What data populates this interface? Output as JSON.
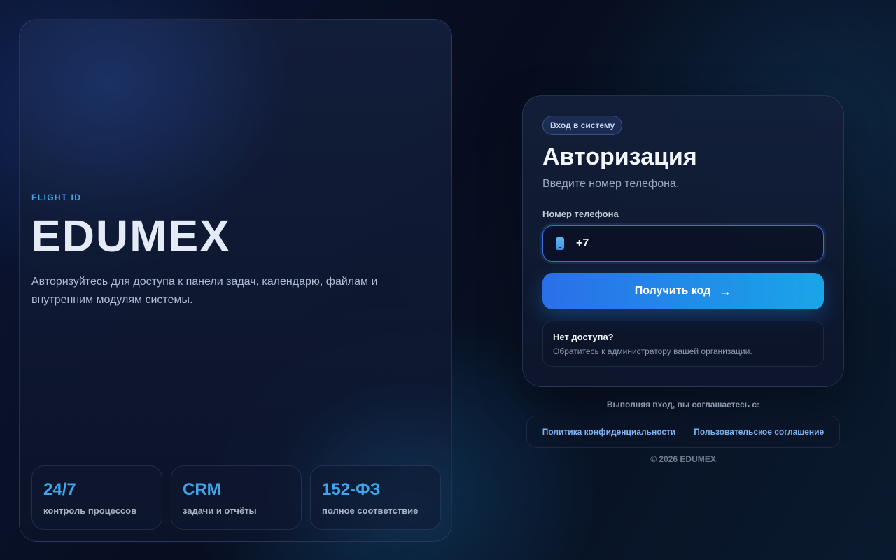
{
  "hero": {
    "eyebrow": "FLIGHT ID",
    "title": "EDUMEX",
    "description": "Авторизуйтесь для доступа к панели задач, календарю, файлам и внутренним модулям системы.",
    "stats": [
      {
        "value": "24/7",
        "label": "контроль процессов"
      },
      {
        "value": "CRM",
        "label": "задачи и отчёты"
      },
      {
        "value": "152-ФЗ",
        "label": "полное соответствие"
      }
    ]
  },
  "login": {
    "badge": "Вход в систему",
    "title": "Авторизация",
    "subtitle": "Введите номер телефона.",
    "phone_label": "Номер телефона",
    "phone_value": "+7",
    "phone_icon": "phone-icon",
    "submit_label": "Получить код",
    "submit_icon": "arrow-right-icon",
    "help_title": "Нет доступа?",
    "help_text": "Обратитесь к администратору вашей организации."
  },
  "footer": {
    "agree_text": "Выполняя вход, вы соглашаетесь с:",
    "privacy_link": "Политика конфиденциальности",
    "terms_link": "Пользовательское соглашение",
    "copyright": "© 2026 EDUMEX"
  },
  "colors": {
    "accent": "#3fa6ec",
    "button_start": "#2a6fe8",
    "button_end": "#1aa5e8",
    "background": "#070d1e"
  }
}
